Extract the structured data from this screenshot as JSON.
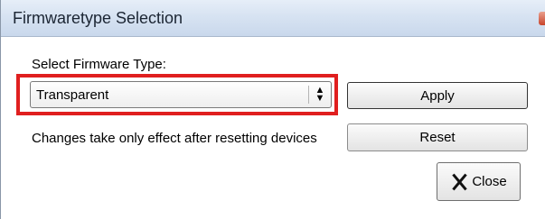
{
  "window": {
    "title": "Firmwaretype Selection"
  },
  "firmware": {
    "label": "Select Firmware Type:",
    "selected": "Transparent",
    "arrow_glyph": "⬍"
  },
  "buttons": {
    "apply": "Apply",
    "reset": "Reset",
    "close": "Close"
  },
  "info": {
    "changes_note": "Changes take only effect after resetting devices"
  },
  "colors": {
    "highlight": "#e01f1f"
  }
}
